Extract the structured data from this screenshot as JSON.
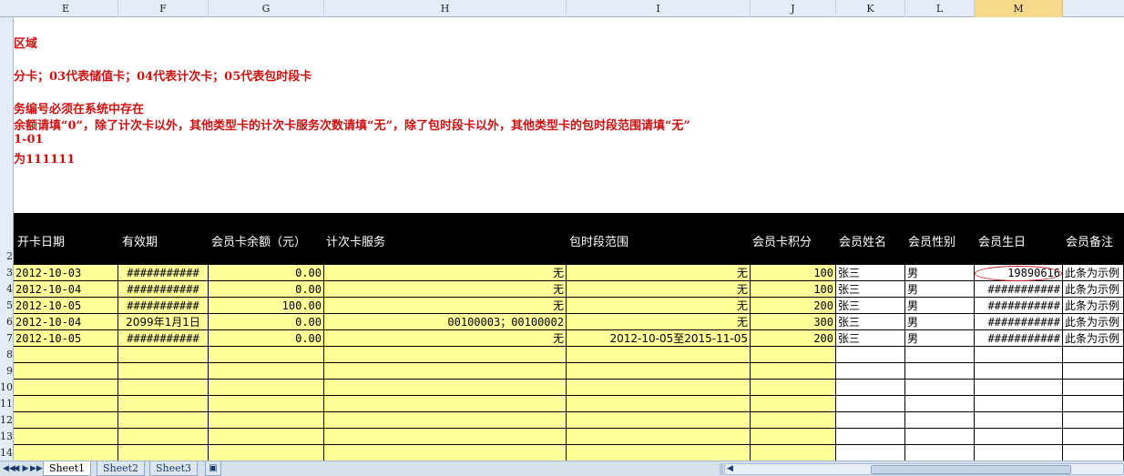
{
  "columns": [
    "E",
    "F",
    "G",
    "H",
    "I",
    "J",
    "K",
    "L",
    "M"
  ],
  "selected_column": "M",
  "row_numbers": [
    "2",
    "3",
    "4",
    "5",
    "6",
    "7",
    "8",
    "9",
    "10",
    "11",
    "12",
    "13",
    "14"
  ],
  "notes": [
    "区域",
    "分卡；03代表储值卡；04代表计次卡；05代表包时段卡",
    "务编号必须在系统中存在",
    "余额请填“0”，除了计次卡以外，其他类型卡的计次卡服务次数请填“无”，除了包时段卡以外，其他类型卡的包时段范围请填“无”",
    "1-01",
    "为111111"
  ],
  "header_row": [
    "开卡日期",
    "有效期",
    "会员卡余额（元）",
    "计次卡服务",
    "包时段范围",
    "会员卡积分",
    "会员姓名",
    "会员性别",
    "会员生日",
    "会员备注"
  ],
  "rows": [
    [
      "2012-10-03",
      "###########",
      "0.00",
      "无",
      "无",
      "100",
      "张三",
      "男",
      "19890616",
      "此条为示例"
    ],
    [
      "2012-10-04",
      "###########",
      "0.00",
      "无",
      "无",
      "100",
      "张三",
      "男",
      "###########",
      "此条为示例"
    ],
    [
      "2012-10-05",
      "###########",
      "100.00",
      "无",
      "无",
      "200",
      "张三",
      "男",
      "###########",
      "此条为示例"
    ],
    [
      "2012-10-04",
      "2099年1月1日",
      "0.00",
      "00100003；00100002",
      "无",
      "300",
      "张三",
      "男",
      "###########",
      "此条为示例"
    ],
    [
      "2012-10-05",
      "###########",
      "0.00",
      "无",
      "2012-10-05至2015-11-05",
      "200",
      "张三",
      "男",
      "###########",
      "此条为示例"
    ]
  ],
  "sheet_tabs": [
    "Sheet1",
    "Sheet2",
    "Sheet3"
  ],
  "active_sheet": "Sheet1",
  "nav_buttons": [
    "◀◀",
    "◀",
    "▶",
    "▶▶"
  ],
  "colors": {
    "note_red": "#cc1111",
    "header_band": "#000000",
    "cell_yellow": "#ffff99",
    "selected_header": "#f8d88a"
  }
}
